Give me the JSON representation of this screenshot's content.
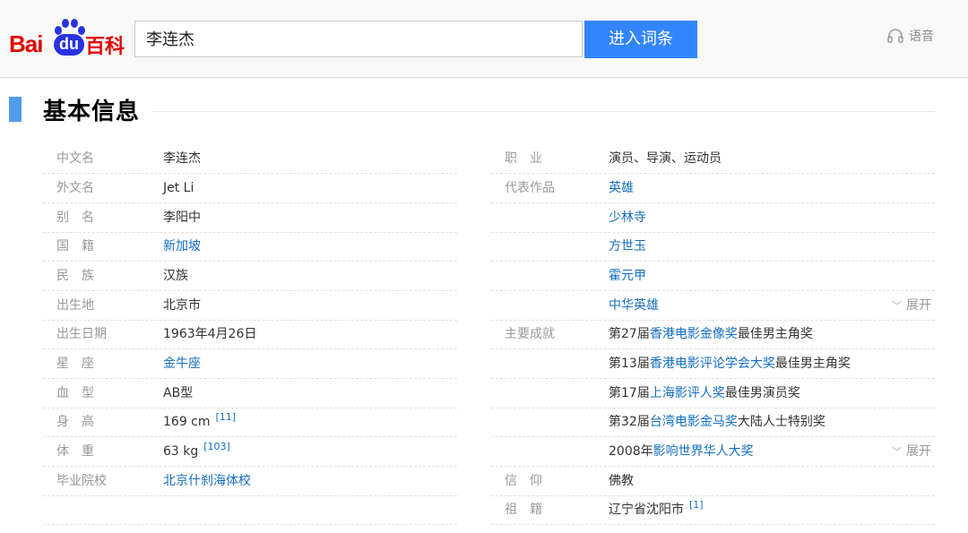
{
  "header": {
    "logo": {
      "bai": "Bai",
      "du": "du",
      "baike": "百科"
    },
    "search": {
      "value": "李连杰"
    },
    "search_button": "进入词条",
    "voice": {
      "icon": "headphones-icon",
      "label": "语音"
    }
  },
  "section": {
    "title": "基本信息"
  },
  "left_rows": [
    {
      "label": "中文名",
      "value": "李连杰",
      "link": false
    },
    {
      "label": "外文名",
      "value": "Jet Li",
      "link": false
    },
    {
      "label": "别名",
      "value": "李阳中",
      "link": false
    },
    {
      "label": "国籍",
      "value": "新加坡",
      "link": true
    },
    {
      "label": "民族",
      "value": "汉族",
      "link": false
    },
    {
      "label": "出生地",
      "value": "北京市",
      "link": false
    },
    {
      "label": "出生日期",
      "value": "1963年4月26日",
      "link": false
    },
    {
      "label": "星座",
      "value": "金牛座",
      "link": true
    },
    {
      "label": "血型",
      "value": "AB型",
      "link": false
    },
    {
      "label": "身高",
      "value": "169 cm",
      "ref": "[11]",
      "link": false
    },
    {
      "label": "体重",
      "value": "63 kg",
      "ref": "[103]",
      "link": false
    },
    {
      "label": "毕业院校",
      "value": "北京什刹海体校",
      "link": true
    }
  ],
  "right_rows": [
    {
      "label": "职业",
      "value": "演员、导演、运动员"
    },
    {
      "label": "代表作品",
      "value": "英雄",
      "link": true
    },
    {
      "label": "",
      "value": "少林寺",
      "link": true
    },
    {
      "label": "",
      "value": "方世玉",
      "link": true
    },
    {
      "label": "",
      "value": "霍元甲",
      "link": true
    },
    {
      "label": "",
      "value": "中华英雄",
      "link": true,
      "expand": "展开"
    },
    {
      "label": "主要成就",
      "pre": "第27届",
      "link_text": "香港电影金像奖",
      "post": "最佳男主角奖"
    },
    {
      "label": "",
      "pre": "第13届",
      "link_text": "香港电影评论学会大奖",
      "post": "最佳男主角奖"
    },
    {
      "label": "",
      "pre": "第17届",
      "link_text": "上海影评人奖",
      "post": "最佳男演员奖"
    },
    {
      "label": "",
      "pre": "第32届",
      "link_text": "台湾电影金马奖",
      "post": "大陆人士特别奖"
    },
    {
      "label": "",
      "pre": "2008年",
      "link_text": "影响世界华人大奖",
      "post": "",
      "expand": "展开"
    },
    {
      "label": "信仰",
      "value": "佛教"
    },
    {
      "label": "祖籍",
      "value": "辽宁省沈阳市",
      "ref": "[1]"
    }
  ],
  "colors": {
    "accent": "#3385ff",
    "link": "#136ec2",
    "brand_red": "#e10602",
    "brand_blue": "#2932e1",
    "section_bar": "#4f9cee"
  }
}
